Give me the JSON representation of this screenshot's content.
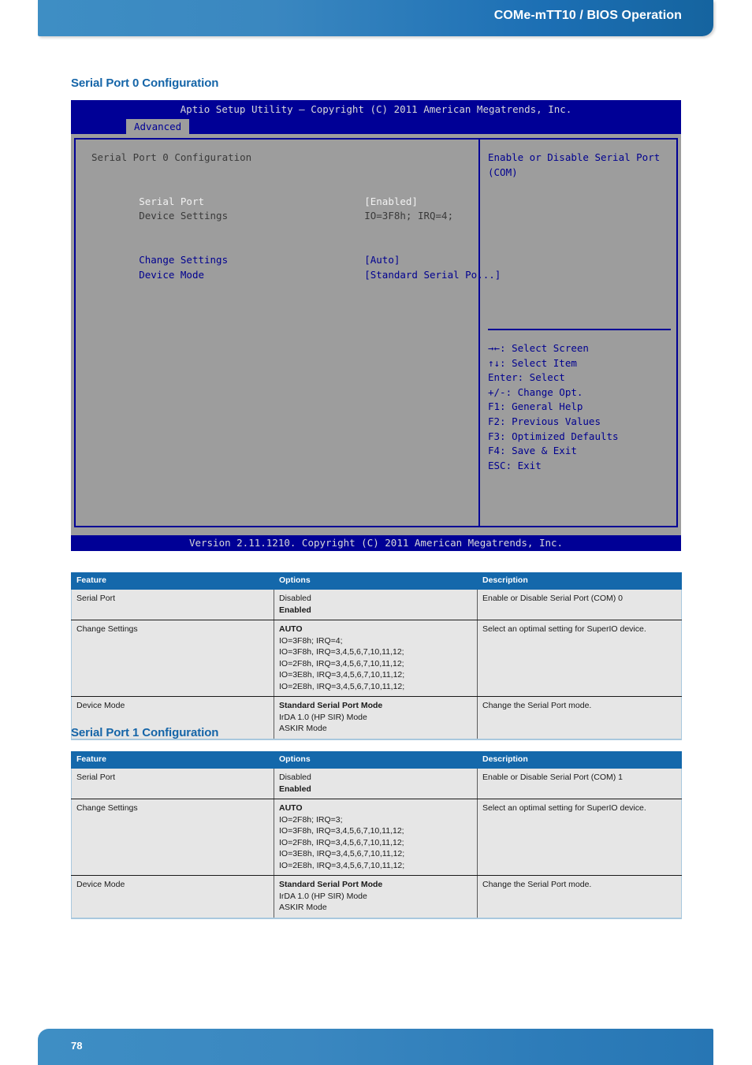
{
  "header": {
    "title": "COMe-mTT10 / BIOS Operation"
  },
  "footer": {
    "page_number": "78"
  },
  "sections": {
    "sp0_heading": "Serial Port 0 Configuration",
    "sp1_heading": "Serial Port 1 Configuration"
  },
  "bios": {
    "title": "Aptio Setup Utility – Copyright (C) 2011 American Megatrends, Inc.",
    "tab": "Advanced",
    "screen_title": "Serial Port 0 Configuration",
    "rows": [
      {
        "label": "Serial Port",
        "value": "[Enabled]"
      },
      {
        "label": "Device Settings",
        "value": "IO=3F8h; IRQ=4;"
      },
      {
        "label": "Change Settings",
        "value": "[Auto]"
      },
      {
        "label": "Device Mode",
        "value": "[Standard Serial Po...]"
      }
    ],
    "help_line1": "Enable or Disable Serial Port",
    "help_line2": "(COM)",
    "keys": [
      "→←: Select Screen",
      "↑↓: Select Item",
      "Enter: Select",
      "+/-: Change Opt.",
      "F1: General Help",
      "F2: Previous Values",
      "F3: Optimized Defaults",
      "F4: Save & Exit",
      "ESC: Exit"
    ],
    "version": "Version 2.11.1210. Copyright (C) 2011 American Megatrends, Inc."
  },
  "table_headers": {
    "feature": "Feature",
    "options": "Options",
    "description": "Description"
  },
  "table_sp0": [
    {
      "feature": "Serial Port",
      "options": [
        {
          "text": "Disabled",
          "bold": false
        },
        {
          "text": "Enabled",
          "bold": true
        }
      ],
      "description": "Enable or Disable Serial Port (COM) 0"
    },
    {
      "feature": "Change Settings",
      "options": [
        {
          "text": "AUTO",
          "bold": true
        },
        {
          "text": "IO=3F8h; IRQ=4;",
          "bold": false
        },
        {
          "text": "IO=3F8h, IRQ=3,4,5,6,7,10,11,12;",
          "bold": false
        },
        {
          "text": "IO=2F8h, IRQ=3,4,5,6,7,10,11,12;",
          "bold": false
        },
        {
          "text": "IO=3E8h, IRQ=3,4,5,6,7,10,11,12;",
          "bold": false
        },
        {
          "text": "IO=2E8h, IRQ=3,4,5,6,7,10,11,12;",
          "bold": false
        }
      ],
      "description": "Select an optimal setting for SuperIO device."
    },
    {
      "feature": "Device Mode",
      "options": [
        {
          "text": "Standard Serial Port Mode",
          "bold": true
        },
        {
          "text": "IrDA 1.0 (HP SIR) Mode",
          "bold": false
        },
        {
          "text": "ASKIR Mode",
          "bold": false
        }
      ],
      "description": "Change the Serial Port mode."
    }
  ],
  "table_sp1": [
    {
      "feature": "Serial Port",
      "options": [
        {
          "text": "Disabled",
          "bold": false
        },
        {
          "text": "Enabled",
          "bold": true
        }
      ],
      "description": "Enable or Disable Serial Port (COM) 1"
    },
    {
      "feature": "Change Settings",
      "options": [
        {
          "text": "AUTO",
          "bold": true
        },
        {
          "text": "IO=2F8h; IRQ=3;",
          "bold": false
        },
        {
          "text": "IO=3F8h, IRQ=3,4,5,6,7,10,11,12;",
          "bold": false
        },
        {
          "text": "IO=2F8h, IRQ=3,4,5,6,7,10,11,12;",
          "bold": false
        },
        {
          "text": "IO=3E8h, IRQ=3,4,5,6,7,10,11,12;",
          "bold": false
        },
        {
          "text": "IO=2E8h, IRQ=3,4,5,6,7,10,11,12;",
          "bold": false
        }
      ],
      "description": "Select an optimal setting for SuperIO device."
    },
    {
      "feature": "Device Mode",
      "options": [
        {
          "text": "Standard Serial Port Mode",
          "bold": true
        },
        {
          "text": "IrDA 1.0 (HP SIR) Mode",
          "bold": false
        },
        {
          "text": "ASKIR Mode",
          "bold": false
        }
      ],
      "description": "Change the Serial Port mode."
    }
  ],
  "colors": {
    "brand_blue": "#1468ab",
    "bios_blue": "#000096",
    "bios_gray": "#9d9d9d"
  }
}
